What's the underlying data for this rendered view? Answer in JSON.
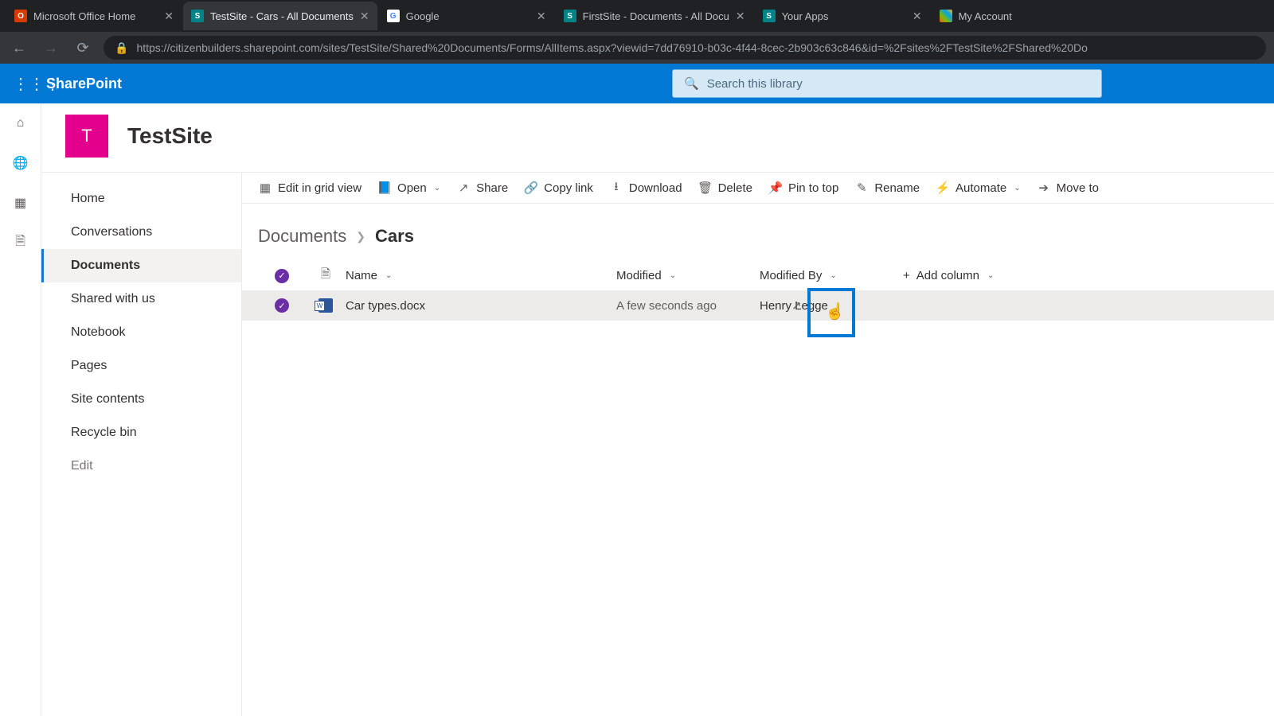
{
  "browser": {
    "tabs": [
      {
        "title": "Microsoft Office Home",
        "favicon_bg": "#d83b01",
        "favicon_txt": "O",
        "active": false
      },
      {
        "title": "TestSite - Cars - All Documents",
        "favicon_bg": "#038387",
        "favicon_txt": "S",
        "active": true
      },
      {
        "title": "Google",
        "favicon_bg": "#fff",
        "favicon_txt": "G",
        "active": false
      },
      {
        "title": "FirstSite - Documents - All Docu",
        "favicon_bg": "#038387",
        "favicon_txt": "S",
        "active": false
      },
      {
        "title": "Your Apps",
        "favicon_bg": "#038387",
        "favicon_txt": "S",
        "active": false
      },
      {
        "title": "My Account",
        "favicon_bg": "#fff",
        "favicon_txt": "⊞",
        "active": false
      }
    ],
    "url_display": "https://citizenbuilders.sharepoint.com/sites/TestSite/Shared%20Documents/Forms/AllItems.aspx?viewid=7dd76910-b03c-4f44-8cec-2b903c63c846&id=%2Fsites%2FTestSite%2FShared%20Do"
  },
  "suite": {
    "brand": "SharePoint",
    "search_placeholder": "Search this library"
  },
  "site": {
    "logo_letter": "T",
    "name": "TestSite"
  },
  "left_nav": [
    {
      "label": "Home",
      "active": false
    },
    {
      "label": "Conversations",
      "active": false
    },
    {
      "label": "Documents",
      "active": true
    },
    {
      "label": "Shared with us",
      "active": false
    },
    {
      "label": "Notebook",
      "active": false
    },
    {
      "label": "Pages",
      "active": false
    },
    {
      "label": "Site contents",
      "active": false
    },
    {
      "label": "Recycle bin",
      "active": false
    },
    {
      "label": "Edit",
      "active": false,
      "muted": true
    }
  ],
  "toolbar": {
    "edit_grid": "Edit in grid view",
    "open": "Open",
    "share": "Share",
    "copy_link": "Copy link",
    "download": "Download",
    "delete": "Delete",
    "pin": "Pin to top",
    "rename": "Rename",
    "automate": "Automate",
    "move": "Move to"
  },
  "breadcrumb": {
    "root": "Documents",
    "leaf": "Cars"
  },
  "columns": {
    "name": "Name",
    "modified": "Modified",
    "modified_by": "Modified By",
    "add": "Add column"
  },
  "rows": [
    {
      "name": "Car types.docx",
      "modified": "A few seconds ago",
      "modified_by": "Henry Legge",
      "selected": true
    }
  ]
}
